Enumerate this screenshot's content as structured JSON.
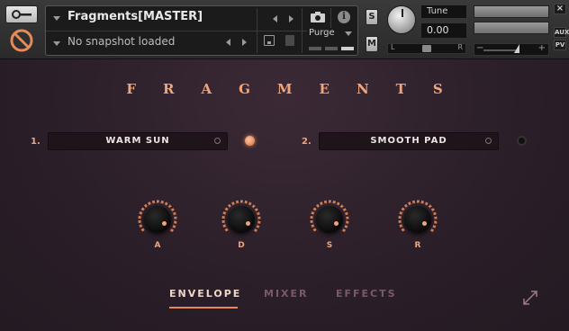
{
  "header": {
    "instrument_name": "Fragments[MASTER]",
    "snapshot_text": "No snapshot loaded",
    "purge_label": "Purge",
    "solo_label": "S",
    "mute_label": "M",
    "tune_label": "Tune",
    "tune_value": "0.00",
    "pan_left": "L",
    "pan_right": "R",
    "vol_minus": "−",
    "vol_plus": "+",
    "close_label": "×",
    "aux_label": "AUX",
    "pv_label": "PV"
  },
  "main": {
    "title": "FRAGMENTS",
    "slots": [
      {
        "number": "1.",
        "name": "WARM SUN",
        "enabled": true
      },
      {
        "number": "2.",
        "name": "SMOOTH PAD",
        "enabled": false
      }
    ],
    "knobs": [
      {
        "label": "A"
      },
      {
        "label": "D"
      },
      {
        "label": "S"
      },
      {
        "label": "R"
      }
    ],
    "tabs": [
      {
        "label": "ENVELOPE",
        "active": true
      },
      {
        "label": "MIXER",
        "active": false
      },
      {
        "label": "EFFECTS",
        "active": false
      }
    ]
  },
  "colors": {
    "accent": "#f0a57a",
    "background": "#2b1f29",
    "field": "#1e1419"
  },
  "icons": [
    "wrench-icon",
    "no-entry-icon",
    "camera-icon",
    "info-icon",
    "save-icon",
    "trash-icon",
    "expand-icon"
  ]
}
